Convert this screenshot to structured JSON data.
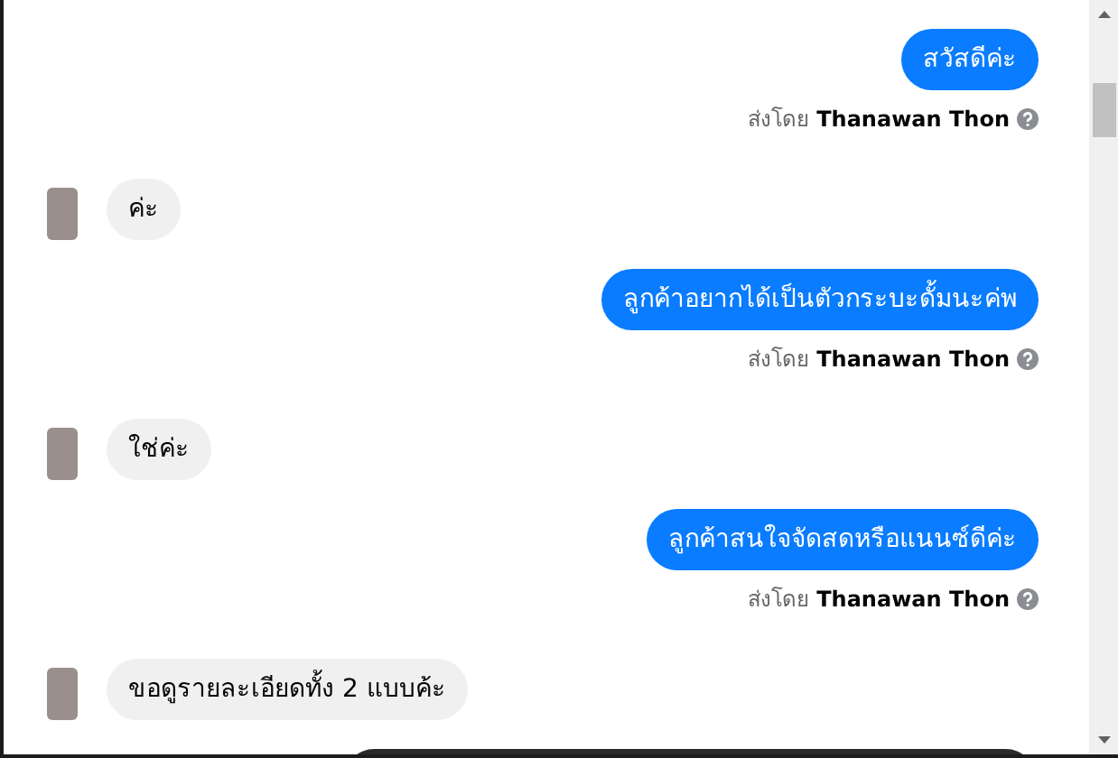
{
  "messages": [
    {
      "kind": "sent",
      "text": "สวัสดีค่ะ",
      "sender_prefix": "ส่งโดย",
      "sender_name": "Thanawan Thon"
    },
    {
      "kind": "received",
      "text": "ค่ะ"
    },
    {
      "kind": "sent",
      "text": "ลูกค้าอยากได้เป็นตัวกระบะดั้มนะค่พ",
      "sender_prefix": "ส่งโดย",
      "sender_name": "Thanawan Thon"
    },
    {
      "kind": "received",
      "text": "ใช่ค่ะ"
    },
    {
      "kind": "sent",
      "text": "ลูกค้าสนใจจัดสดหรือแนนซ์ดีค่ะ",
      "sender_prefix": "ส่งโดย",
      "sender_name": "Thanawan Thon"
    },
    {
      "kind": "received",
      "text": "ขอดูรายละเอียดทั้ง 2 แบบค้ะ"
    },
    {
      "kind": "image"
    }
  ]
}
